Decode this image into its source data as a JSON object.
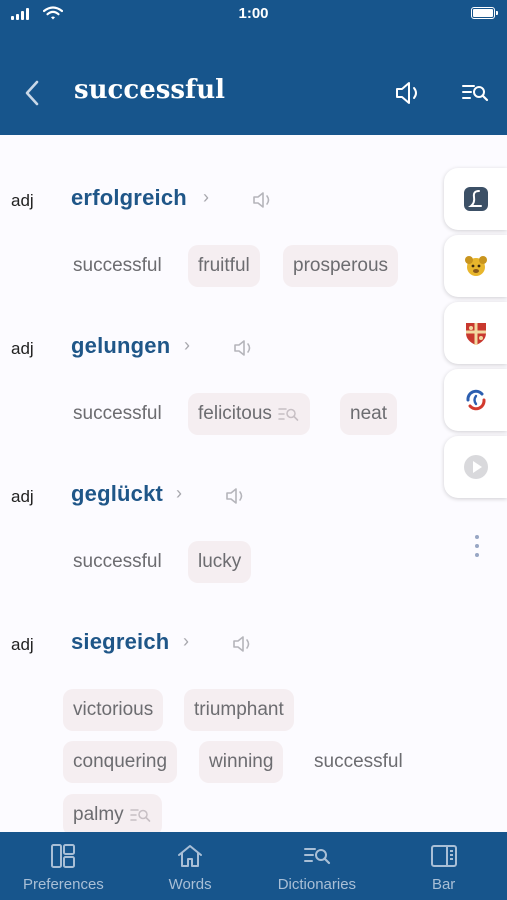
{
  "status_bar": {
    "time": "1:00"
  },
  "header": {
    "title": "successful"
  },
  "entries": [
    {
      "pos": "adj",
      "headword": "erfolgreich",
      "translations": [
        {
          "text": "successful",
          "highlighted": false
        },
        {
          "text": "fruitful",
          "highlighted": true
        },
        {
          "text": "prosperous",
          "highlighted": true
        }
      ]
    },
    {
      "pos": "adj",
      "headword": "gelungen",
      "translations": [
        {
          "text": "successful",
          "highlighted": false
        },
        {
          "text": "felicitous",
          "highlighted": true,
          "lookup_icon": true
        },
        {
          "text": "neat",
          "highlighted": true
        }
      ]
    },
    {
      "pos": "adj",
      "headword": "geglückt",
      "translations": [
        {
          "text": "successful",
          "highlighted": false
        },
        {
          "text": "lucky",
          "highlighted": true
        }
      ]
    },
    {
      "pos": "adj",
      "headword": "siegreich",
      "translations": [
        {
          "text": "victorious",
          "highlighted": true
        },
        {
          "text": "triumphant",
          "highlighted": true
        },
        {
          "text": "conquering",
          "highlighted": true
        },
        {
          "text": "winning",
          "highlighted": true
        },
        {
          "text": "successful",
          "highlighted": false
        },
        {
          "text": "palmy",
          "highlighted": true,
          "lookup_icon": true
        }
      ]
    }
  ],
  "side_dictionaries": [
    {
      "icon": "script-l-dictionary-icon"
    },
    {
      "icon": "dog-dictionary-icon"
    },
    {
      "icon": "shield-dictionary-icon"
    },
    {
      "icon": "swirl-dictionary-icon"
    },
    {
      "icon": "play-dictionary-icon"
    }
  ],
  "tabs": [
    {
      "label": "Preferences",
      "icon": "preferences-icon"
    },
    {
      "label": "Words",
      "icon": "home-icon"
    },
    {
      "label": "Dictionaries",
      "icon": "dictionary-search-icon"
    },
    {
      "label": "Bar",
      "icon": "sidebar-icon"
    }
  ],
  "colors": {
    "bar": "#17558c",
    "headword": "#1f5688",
    "chip": "#f5eef1",
    "tab_inactive": "#a9bfd6"
  }
}
